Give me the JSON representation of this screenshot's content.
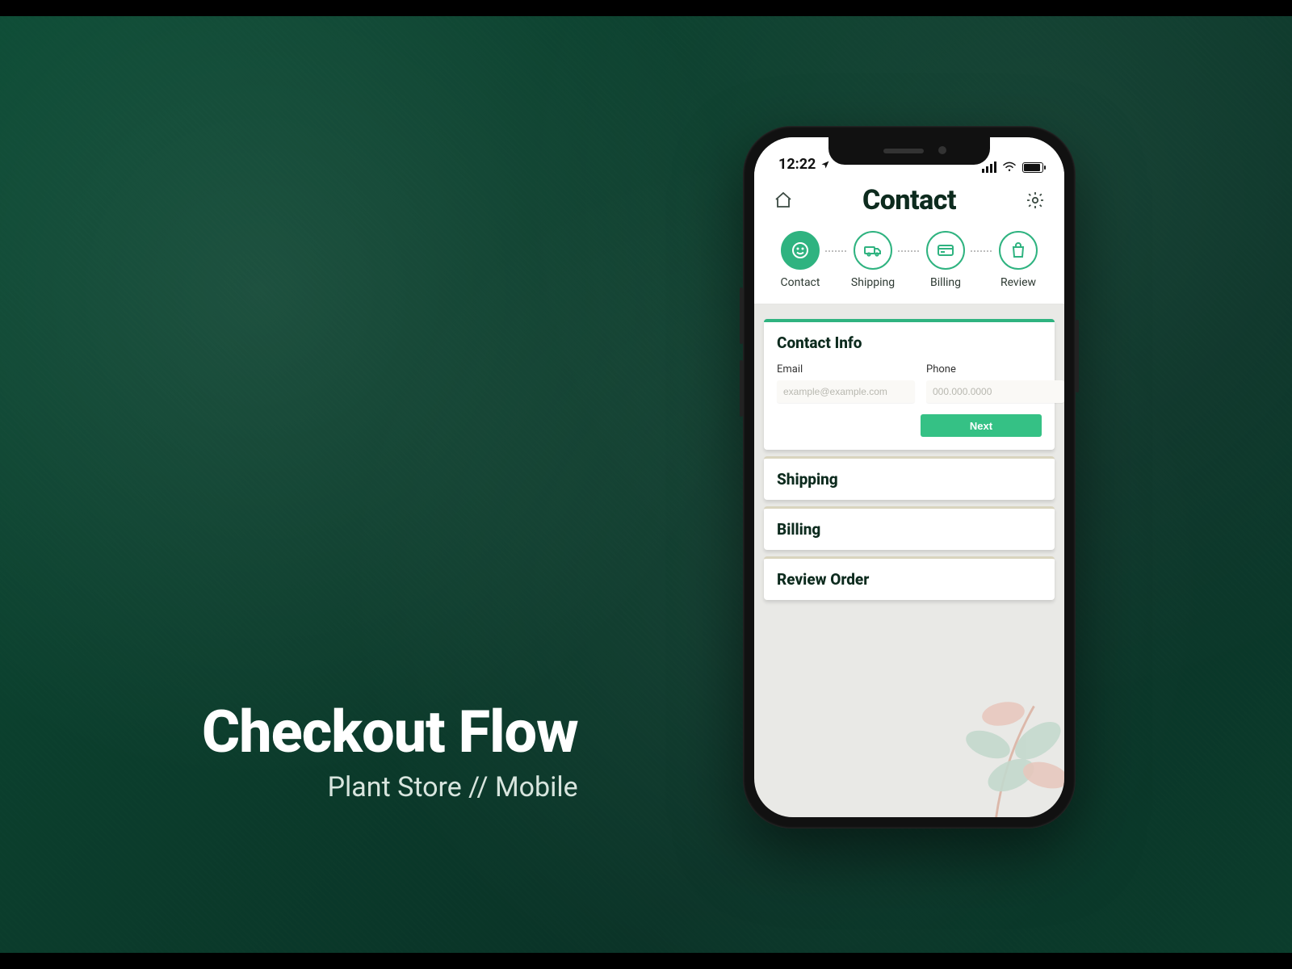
{
  "hero": {
    "title": "Checkout Flow",
    "subtitle": "Plant Store // Mobile"
  },
  "statusbar": {
    "time": "12:22"
  },
  "header": {
    "title": "Contact"
  },
  "steps": [
    {
      "label": "Contact",
      "icon": "smiley",
      "active": true
    },
    {
      "label": "Shipping",
      "icon": "truck",
      "active": false
    },
    {
      "label": "Billing",
      "icon": "card",
      "active": false
    },
    {
      "label": "Review",
      "icon": "bag",
      "active": false
    }
  ],
  "contact_card": {
    "title": "Contact Info",
    "email_label": "Email",
    "email_placeholder": "example@example.com",
    "phone_label": "Phone",
    "phone_placeholder": "000.000.0000",
    "next_label": "Next"
  },
  "collapsed": {
    "shipping": "Shipping",
    "billing": "Billing",
    "review": "Review Order"
  }
}
